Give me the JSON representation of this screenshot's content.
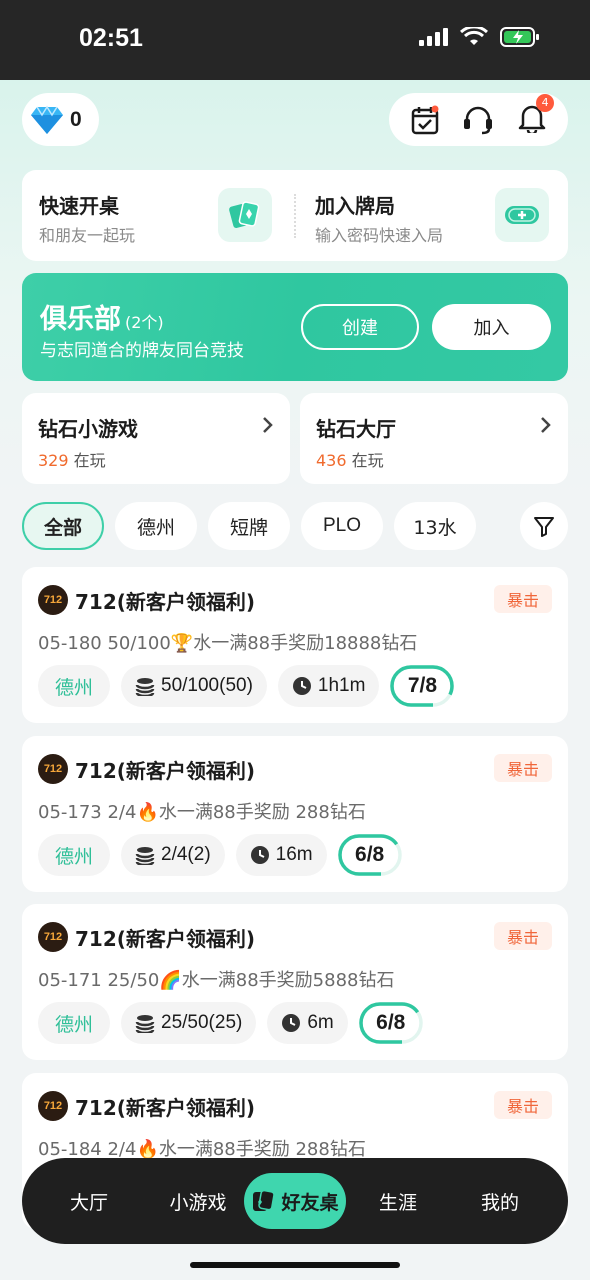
{
  "status_bar": {
    "time": "02:51"
  },
  "header": {
    "diamond_count": "0",
    "notification_count": "4"
  },
  "quick_actions": [
    {
      "title": "快速开桌",
      "subtitle": "和朋友一起玩"
    },
    {
      "title": "加入牌局",
      "subtitle": "输入密码快速入局"
    }
  ],
  "club": {
    "title": "俱乐部",
    "count": "(2个)",
    "subtitle": "与志同道合的牌友同台竞技",
    "create_label": "创建",
    "join_label": "加入"
  },
  "mini_cards": [
    {
      "title": "钻石小游戏",
      "count": "329",
      "suffix": " 在玩"
    },
    {
      "title": "钻石大厅",
      "count": "436",
      "suffix": " 在玩"
    }
  ],
  "filters": [
    "全部",
    "德州",
    "短牌",
    "PLO",
    "13水"
  ],
  "active_filter": "全部",
  "tables": [
    {
      "logo": "712",
      "name": "712(新客户领福利)",
      "tag": "暴击",
      "desc": "05-180 50/100🏆水一满88手奖励18888钻石",
      "game": "德州",
      "blinds": "50/100(50)",
      "time": "1h1m",
      "seats": "7/8",
      "filled": 7,
      "total": 8
    },
    {
      "logo": "712",
      "name": "712(新客户领福利)",
      "tag": "暴击",
      "desc": "05-173 2/4🔥水一满88手奖励 288钻石",
      "game": "德州",
      "blinds": "2/4(2)",
      "time": "16m",
      "seats": "6/8",
      "filled": 6,
      "total": 8
    },
    {
      "logo": "712",
      "name": "712(新客户领福利)",
      "tag": "暴击",
      "desc": "05-171 25/50🌈水一满88手奖励5888钻石",
      "game": "德州",
      "blinds": "25/50(25)",
      "time": "6m",
      "seats": "6/8",
      "filled": 6,
      "total": 8
    },
    {
      "logo": "712",
      "name": "712(新客户领福利)",
      "tag": "暴击",
      "desc": "05-184 2/4🔥水一满88手奖励 288钻石"
    }
  ],
  "bottom_nav": [
    "大厅",
    "小游戏",
    "好友桌",
    "生涯",
    "我的"
  ],
  "colors": {
    "accent": "#3ecfa8",
    "tag_text": "#f0663a",
    "count_text": "#f06a2d"
  }
}
